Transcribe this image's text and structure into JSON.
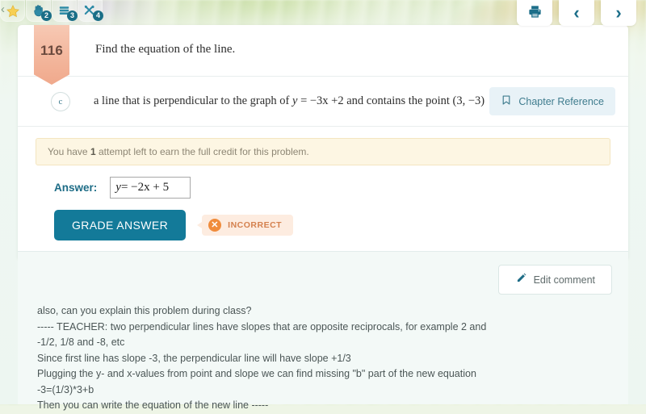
{
  "toolbar": {
    "left_icons": [
      {
        "icon": "star-icon",
        "name": "favorite",
        "badge": null
      },
      {
        "icon": "hand-icon",
        "name": "raise-hand",
        "badge": "2"
      },
      {
        "icon": "books-icon",
        "name": "textbook",
        "badge": "3"
      },
      {
        "icon": "tools-icon",
        "name": "tools",
        "badge": "4"
      }
    ],
    "right_buttons": [
      {
        "icon": "printer-icon",
        "name": "print",
        "label": ""
      },
      {
        "icon": "chevron-left-icon",
        "name": "previous",
        "label": "‹"
      },
      {
        "icon": "chevron-right-icon",
        "name": "next",
        "label": "›"
      }
    ]
  },
  "problem": {
    "number": "116",
    "title": "Find the equation of the line.",
    "subquestion": {
      "letter": "c",
      "text_before": "a line that is perpendicular to the graph of ",
      "math_y": "y",
      "math_rest": " = −3x +2",
      "text_after": " and contains the point (3, −3)"
    },
    "chapter_reference_label": "Chapter Reference"
  },
  "answer_area": {
    "attempt_notice_prefix": "You have ",
    "attempts_left": "1",
    "attempt_notice_suffix": " attempt left to earn the full credit for this problem.",
    "answer_label": "Answer:",
    "answer_value_y": "y",
    "answer_value_rest": " =  −2x + 5",
    "grade_button_label": "GRADE ANSWER",
    "result_badge_label": "INCORRECT",
    "result_badge_icon": "x-circle-icon"
  },
  "comment_area": {
    "edit_button_label": "Edit comment",
    "lines": [
      "also, can you explain this problem during class?",
      "----- TEACHER: two perpendicular lines have slopes that are opposite reciprocals, for example 2 and",
      "-1/2, 1/8 and -8, etc",
      "Since first line has slope -3, the perpendicular line will have slope +1/3",
      "Plugging the y- and x-values from point and slope we can find missing \"b\" part of the new equation",
      "-3=(1/3)*3+b",
      "Then you can write the equation of the new line -----"
    ]
  },
  "colors": {
    "accent_teal": "#137a99",
    "ribbon_peach": "#f3b69c",
    "incorrect_orange": "#f08c3c",
    "notice_yellow": "#fdf6e3",
    "comment_bg": "#f3f9f7"
  }
}
